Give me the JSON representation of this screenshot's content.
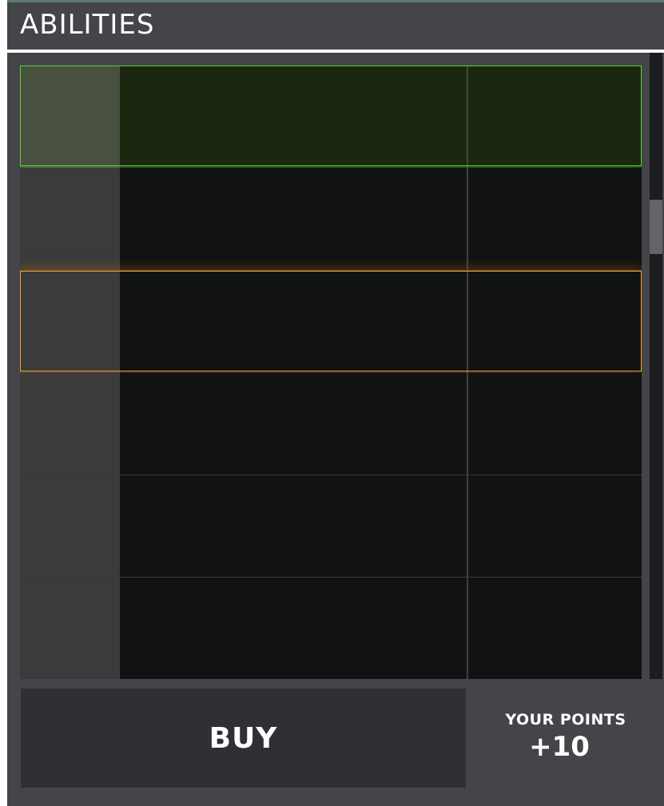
{
  "panel": {
    "title": "ABILITIES"
  },
  "colors": {
    "header_bg": "#434548",
    "selected_border": "#5ad13e",
    "highlight_border": "#f0a22a",
    "row_bg": "#111212"
  },
  "abilities": {
    "rows": [
      {
        "state": "selected"
      },
      {
        "state": "normal"
      },
      {
        "state": "highlight"
      },
      {
        "state": "normal"
      },
      {
        "state": "normal"
      },
      {
        "state": "normal"
      }
    ]
  },
  "footer": {
    "buy_label": "BUY",
    "points_label": "YOUR POINTS",
    "points_value": "+10"
  }
}
